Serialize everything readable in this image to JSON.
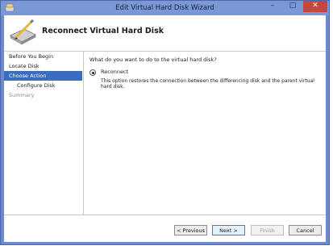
{
  "window": {
    "title": "Edit Virtual Hard Disk Wizard",
    "controls": {
      "minimize": "–",
      "maximize": "□",
      "close": "✕"
    }
  },
  "header": {
    "title": "Reconnect Virtual Hard Disk",
    "icon": "wizard-disk-icon"
  },
  "sidebar": {
    "items": [
      {
        "label": "Before You Begin",
        "state": "normal"
      },
      {
        "label": "Locate Disk",
        "state": "normal"
      },
      {
        "label": "Choose Action",
        "state": "active"
      },
      {
        "label": "Configure Disk",
        "state": "sub"
      },
      {
        "label": "Summary",
        "state": "disabled"
      }
    ]
  },
  "content": {
    "question": "What do you want to do to the virtual hard disk?",
    "option_label": "Reconnect",
    "option_description": "This option restores the connection between the differencing disk and the parent virtual hard disk.",
    "option_selected": true
  },
  "buttons": {
    "previous": "< Previous",
    "next": "Next >",
    "finish": "Finish",
    "cancel": "Cancel"
  },
  "colors": {
    "frame": "#6d8ac9",
    "selection": "#3c6cc2",
    "close_button": "#c7463d"
  }
}
